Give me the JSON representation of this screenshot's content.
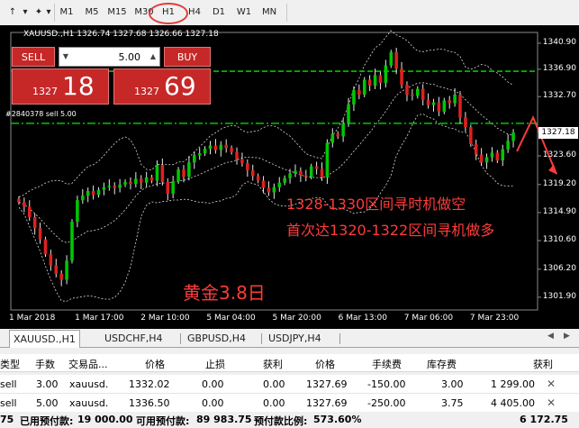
{
  "toolbar": {
    "timeframes": [
      "M1",
      "M5",
      "M15",
      "M30",
      "H1",
      "H4",
      "D1",
      "W1",
      "MN"
    ],
    "selected": "H1"
  },
  "chart": {
    "title": "XAUUSD.,H1  1326.74 1327.68 1326.66 1327.18",
    "order_label": "#2840378 sell 5.00",
    "sell_label": "SELL",
    "buy_label": "BUY",
    "lot": "5.00",
    "sell_price_small": "1327",
    "sell_price_big": "18",
    "buy_price_small": "1327",
    "buy_price_big": "69",
    "current_price": "1327.18",
    "annotation_title": "黄金3.8日",
    "annotation_line1": "1328-1330区间寻时机做空",
    "annotation_line2": "首次达1320-1322区间寻机做多"
  },
  "chart_data": {
    "type": "candlestick",
    "symbol": "XAUUSD.",
    "timeframe": "H1",
    "y_ticks": [
      "1340.90",
      "1336.90",
      "1332.70",
      "1327.18",
      "1323.60",
      "1319.20",
      "1314.90",
      "1310.60",
      "1306.20",
      "1301.90"
    ],
    "x_ticks": [
      "1 Mar 2018",
      "1 Mar 17:00",
      "2 Mar 10:00",
      "5 Mar 04:00",
      "5 Mar 20:00",
      "6 Mar 13:00",
      "7 Mar 06:00",
      "7 Mar 23:00"
    ],
    "ylim": [
      1300.5,
      1342.0
    ],
    "horizontal_lines": [
      {
        "price": 1336.6,
        "style": "dashed",
        "color": "#00c800"
      },
      {
        "price": 1328.6,
        "style": "dash-dot",
        "color": "#00c800",
        "label": "#2840378 sell 5.00"
      }
    ],
    "closes": [
      1316.5,
      1315.8,
      1314.2,
      1312.5,
      1310.8,
      1308.5,
      1306.8,
      1305.5,
      1304.6,
      1307.5,
      1313.5,
      1316.8,
      1317.5,
      1318.2,
      1317.6,
      1318.4,
      1318.8,
      1319.0,
      1318.7,
      1319.2,
      1319.6,
      1319.3,
      1320.1,
      1319.5,
      1320.3,
      1319.8,
      1322.2,
      1319.6,
      1317.8,
      1319.7,
      1321.5,
      1320.4,
      1322.6,
      1323.7,
      1324.0,
      1324.7,
      1325.2,
      1324.5,
      1325.3,
      1324.8,
      1324.2,
      1323.1,
      1322.5,
      1321.4,
      1320.5,
      1319.8,
      1318.7,
      1318.0,
      1318.8,
      1319.5,
      1320.2,
      1320.9,
      1321.3,
      1320.6,
      1320.4,
      1322.0,
      1321.6,
      1320.3,
      1325.6,
      1327.0,
      1326.6,
      1328.6,
      1331.5,
      1333.7,
      1333.0,
      1335.3,
      1334.4,
      1336.0,
      1334.8,
      1337.5,
      1339.5,
      1337.0,
      1334.5,
      1333.0,
      1332.8,
      1333.9,
      1332.2,
      1331.4,
      1331.8,
      1330.4,
      1332.1,
      1331.7,
      1333.0,
      1329.5,
      1328.0,
      1325.4,
      1323.8,
      1322.6,
      1323.4,
      1324.1,
      1322.9,
      1324.6,
      1325.9,
      1327.18
    ]
  },
  "terminal": {
    "tabs": [
      "XAUUSD.,H1",
      "USDCHF,H4",
      "GBPUSD,H4",
      "USDJPY,H4"
    ],
    "columns": [
      "类型",
      "手数",
      "交易品...",
      "价格",
      "止损",
      "获利",
      "价格",
      "手续费",
      "库存费",
      "获利"
    ],
    "rows": [
      {
        "type": "sell",
        "lots": "3.00",
        "symbol": "xauusd.",
        "open_price": "1332.02",
        "sl": "0.00",
        "tp": "0.00",
        "price": "1327.69",
        "commission": "-150.00",
        "swap": "3.00",
        "profit": "1 299.00"
      },
      {
        "type": "sell",
        "lots": "5.00",
        "symbol": "xauusd.",
        "open_price": "1336.50",
        "sl": "0.00",
        "tp": "0.00",
        "price": "1327.69",
        "commission": "-250.00",
        "swap": "3.75",
        "profit": "4 405.00"
      }
    ],
    "summary": {
      "prefix": "75",
      "used_label": "已用预付款:",
      "used_value": "19 000.00",
      "free_label": "可用预付款:",
      "free_value": "89 983.75",
      "ratio_label": "预付款比例:",
      "ratio_value": "573.60%",
      "total_profit": "6 172.75"
    }
  }
}
